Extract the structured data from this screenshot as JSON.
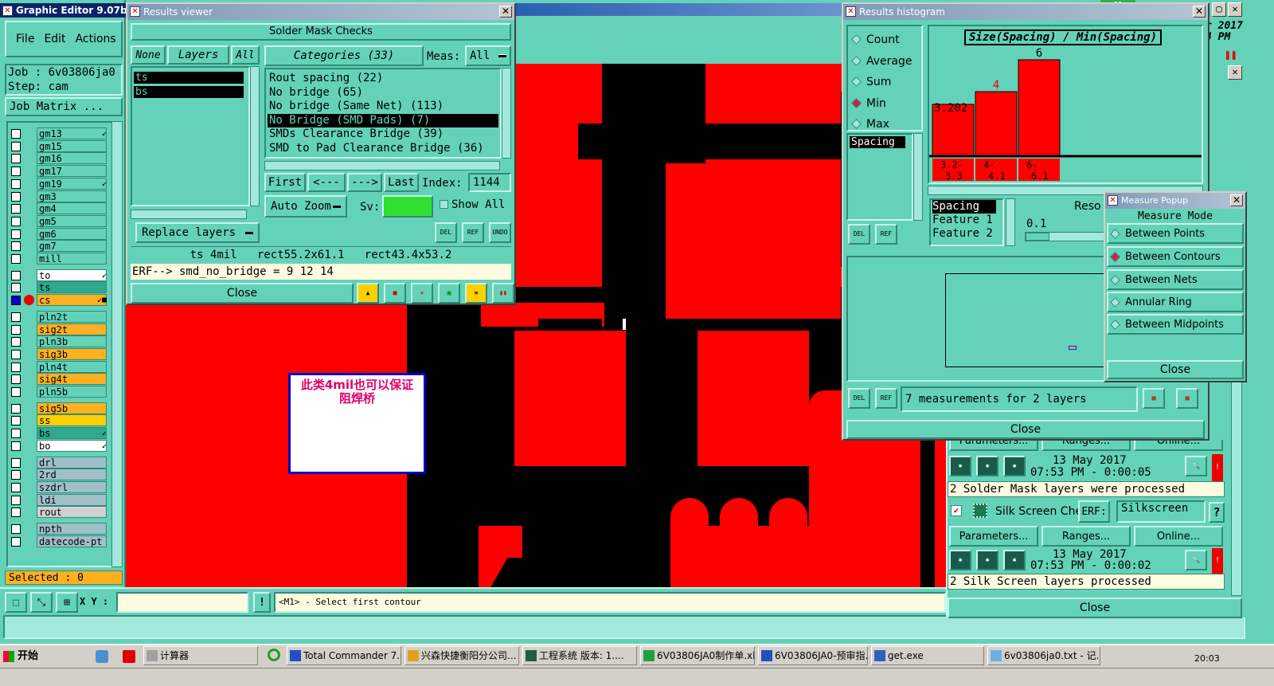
{
  "main_window": {
    "title": "Graphic Editor 9.07b2 (0",
    "menu": [
      "File",
      "Edit",
      "Actions"
    ],
    "job": "Job : 6v03806ja0",
    "step": "Step: cam",
    "job_matrix": "Job Matrix ...",
    "layers": [
      {
        "name": "gm13",
        "color": "#64d2b8",
        "mark": "↙"
      },
      {
        "name": "gm15",
        "color": "#64d2b8",
        "mark": ""
      },
      {
        "name": "gm16",
        "color": "#64d2b8",
        "mark": ""
      },
      {
        "name": "gm17",
        "color": "#64d2b8",
        "mark": ""
      },
      {
        "name": "gm19",
        "color": "#64d2b8",
        "mark": "↙"
      },
      {
        "name": "gm3",
        "color": "#64d2b8",
        "mark": ""
      },
      {
        "name": "gm4",
        "color": "#64d2b8",
        "mark": ""
      },
      {
        "name": "gm5",
        "color": "#64d2b8",
        "mark": ""
      },
      {
        "name": "gm6",
        "color": "#64d2b8",
        "mark": ""
      },
      {
        "name": "gm7",
        "color": "#64d2b8",
        "mark": ""
      },
      {
        "name": "mill",
        "color": "#64d2b8",
        "mark": ""
      },
      {
        "name": "to",
        "color": "#ffffff",
        "mark": "↙"
      },
      {
        "name": "ts",
        "color": "#2fa88c",
        "mark": ""
      },
      {
        "name": "cs",
        "color": "#ffb020",
        "mark": "↙■"
      },
      {
        "name": "pln2t",
        "color": "#64d2b8",
        "mark": ""
      },
      {
        "name": "sig2t",
        "color": "#ffb020",
        "mark": ""
      },
      {
        "name": "pln3b",
        "color": "#64d2b8",
        "mark": ""
      },
      {
        "name": "sig3b",
        "color": "#ffb020",
        "mark": ""
      },
      {
        "name": "pln4t",
        "color": "#64d2b8",
        "mark": ""
      },
      {
        "name": "sig4t",
        "color": "#ffb020",
        "mark": ""
      },
      {
        "name": "pln5b",
        "color": "#64d2b8",
        "mark": ""
      },
      {
        "name": "sig5b",
        "color": "#ffb020",
        "mark": ""
      },
      {
        "name": "ss",
        "color": "#ffd000",
        "mark": ""
      },
      {
        "name": "bs",
        "color": "#2fa88c",
        "mark": "↙"
      },
      {
        "name": "bo",
        "color": "#ffffff",
        "mark": "↙"
      },
      {
        "name": "drl",
        "color": "#a0c0c8",
        "mark": ""
      },
      {
        "name": "2rd",
        "color": "#a0c0c8",
        "mark": ""
      },
      {
        "name": "szdrl",
        "color": "#a0c0c8",
        "mark": ""
      },
      {
        "name": "ldi",
        "color": "#a0c0c8",
        "mark": ""
      },
      {
        "name": "rout",
        "color": "#d0d0d0",
        "mark": ""
      },
      {
        "name": "npth",
        "color": "#a0c0c8",
        "mark": ""
      },
      {
        "name": "datecode-pt",
        "color": "#a0c0c8",
        "mark": ""
      }
    ],
    "selected": "Selected : 0",
    "xy_label": "X Y :",
    "xy_value": "",
    "prompt": "<M1> - Select first contour",
    "top_right_text": "r 2017\n4 PM",
    "badge": "61"
  },
  "annotation": {
    "text": "此类4mil也可以保证阻焊桥"
  },
  "results_viewer": {
    "title": "Results viewer",
    "header": "Solder Mask Checks",
    "none_label": "None",
    "layers_label": "Layers",
    "all_label": "All",
    "layer_items": [
      "ts",
      "bs"
    ],
    "categories_label": "Categories (33)",
    "meas_label": "Meas:",
    "meas_value": "All",
    "categories": [
      "Rout spacing (22)",
      "No bridge (65)",
      "No bridge (Same Net) (113)",
      "No Bridge (SMD Pads) (7)",
      "SMDs Clearance Bridge (39)",
      "SMD to Pad Clearance Bridge (36)"
    ],
    "nav": {
      "first": "First",
      "prev": "<---",
      "next": "--->",
      "last": "Last",
      "index_label": "Index:",
      "index_value": "1144"
    },
    "auto_zoom": "Auto Zoom",
    "sv_label": "Sv:",
    "show_all": "Show All",
    "replace_layers": "Replace layers",
    "icons": {
      "del": "DEL",
      "ref": "REF",
      "undo": "UNDO"
    },
    "info": "ts 4mil   rect55.2x61.1   rect43.4x53.2",
    "erf": "ERF--> smd_no_bridge = 9 12 14",
    "close": "Close"
  },
  "histogram": {
    "title": "Results histogram",
    "options": [
      {
        "label": "Count",
        "on": false
      },
      {
        "label": "Average",
        "on": false
      },
      {
        "label": "Sum",
        "on": false
      },
      {
        "label": "Min",
        "on": true
      },
      {
        "label": "Max",
        "on": false
      }
    ],
    "spacing_label": "Spacing",
    "formula": "Size(Spacing) / Min(Spacing)",
    "chart_data": {
      "type": "bar",
      "title": "Size(Spacing) / Min(Spacing)",
      "categories": [
        "3.2-\n3.3",
        "4-\n4.1",
        "6-\n6.1"
      ],
      "values": [
        3.202,
        4,
        6
      ],
      "value_labels": [
        "3.202",
        "4",
        "6"
      ],
      "ylim": [
        0,
        6
      ]
    },
    "bin_labels": [
      [
        "3.2-",
        "3.3"
      ],
      [
        "4-",
        "4.1"
      ],
      [
        "6-",
        "6.1"
      ]
    ],
    "legend_rows": [
      "Spacing",
      "Feature 1",
      "Feature 2"
    ],
    "reso_label": "Reso",
    "reso_value": "0.1",
    "measurements": "7 measurements for 2 layers",
    "icons": {
      "del": "DEL",
      "ref": "REF"
    },
    "close": "Close"
  },
  "measure_popup": {
    "title": "Measure Popup",
    "mode_label": "Measure Mode",
    "modes": [
      {
        "label": "Between Points",
        "on": false
      },
      {
        "label": "Between Contours",
        "on": true
      },
      {
        "label": "Between Nets",
        "on": false
      },
      {
        "label": "Annular Ring",
        "on": false
      },
      {
        "label": "Between Midpoints",
        "on": false
      }
    ],
    "close": "Close"
  },
  "checklist": {
    "partial_buttons": [
      "Parameters...",
      "Ranges...",
      "Online..."
    ],
    "row1_date": "13 May 2017",
    "row1_time": "07:53 PM - 0:00:05",
    "row1_status": "2 Solder Mask layers were processed",
    "silk_label": "Silk Screen Che",
    "erf_label": "ERF:",
    "erf_value": "Silkscreen",
    "help": "?",
    "buttons": [
      "Parameters...",
      "Ranges...",
      "Online..."
    ],
    "row2_date": "13 May 2017",
    "row2_time": "07:53 PM - 0:00:02",
    "row2_status": "2 Silk Screen layers processed",
    "close": "Close"
  },
  "taskbar": {
    "start": "开始",
    "tasks": [
      "计算器",
      "Total Commander 7.0 ...",
      "兴森快捷衡阳分公司...",
      "工程系统  版本: 1....",
      "6V03806JA0制作单.xl...",
      "6V03806JA0-预审指...",
      "get.exe",
      "6v03806ja0.txt - 记..."
    ],
    "clock": "20:03"
  }
}
